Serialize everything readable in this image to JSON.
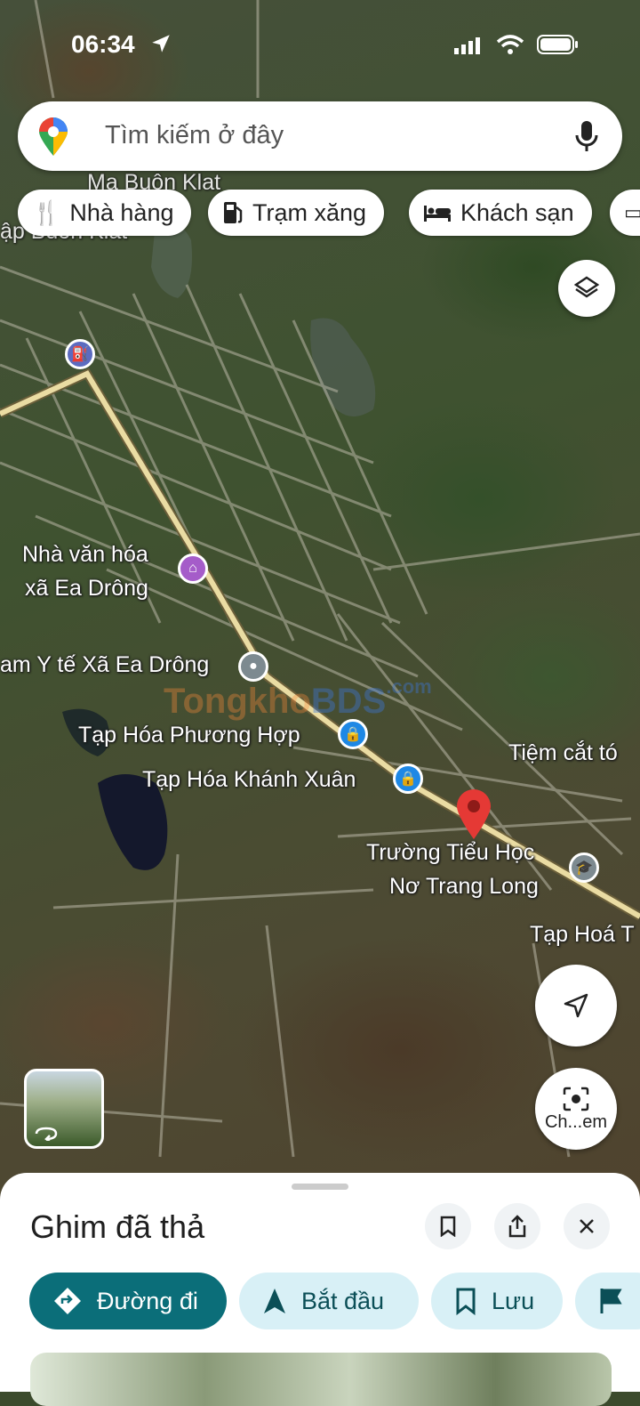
{
  "status_bar": {
    "time": "06:34"
  },
  "search": {
    "placeholder": "Tìm kiếm ở đây"
  },
  "chips": [
    {
      "label": "Nhà hàng",
      "icon": "restaurant-icon"
    },
    {
      "label": "Trạm xăng",
      "icon": "gas-station-icon"
    },
    {
      "label": "Khách sạn",
      "icon": "hotel-icon"
    }
  ],
  "map_labels": {
    "village_top": "Ma Buôn Klat",
    "village_top2": "ập Buôn Klat",
    "cultural_house_line1": "Nhà văn hóa",
    "cultural_house_line2": "xã Ea Drông",
    "health_station": "am Y tế Xã Ea Drông",
    "shop1": "Tạp Hóa Phương Hợp",
    "shop2": "Tạp Hóa Khánh Xuân",
    "barber": "Tiệm cắt tó",
    "school_line1": "Trường Tiểu Học",
    "school_line2": "Nơ Trang Long",
    "shop3": "Tạp Hoá T"
  },
  "watermark": {
    "part1": "Tongkho",
    "part2": "BDS",
    "suffix": ".com"
  },
  "lens_button": {
    "label": "Ch...em"
  },
  "sheet": {
    "title": "Ghim đã thả",
    "actions": [
      {
        "label": "Đường đi",
        "icon": "directions-icon"
      },
      {
        "label": "Bắt đầu",
        "icon": "navigation-arrow-icon"
      },
      {
        "label": "Lưu",
        "icon": "bookmark-icon"
      }
    ]
  },
  "colors": {
    "accent": "#0b6e79",
    "chip_bg": "#d8f0f6",
    "pin": "#e53935",
    "road": "#e8d9a0"
  }
}
